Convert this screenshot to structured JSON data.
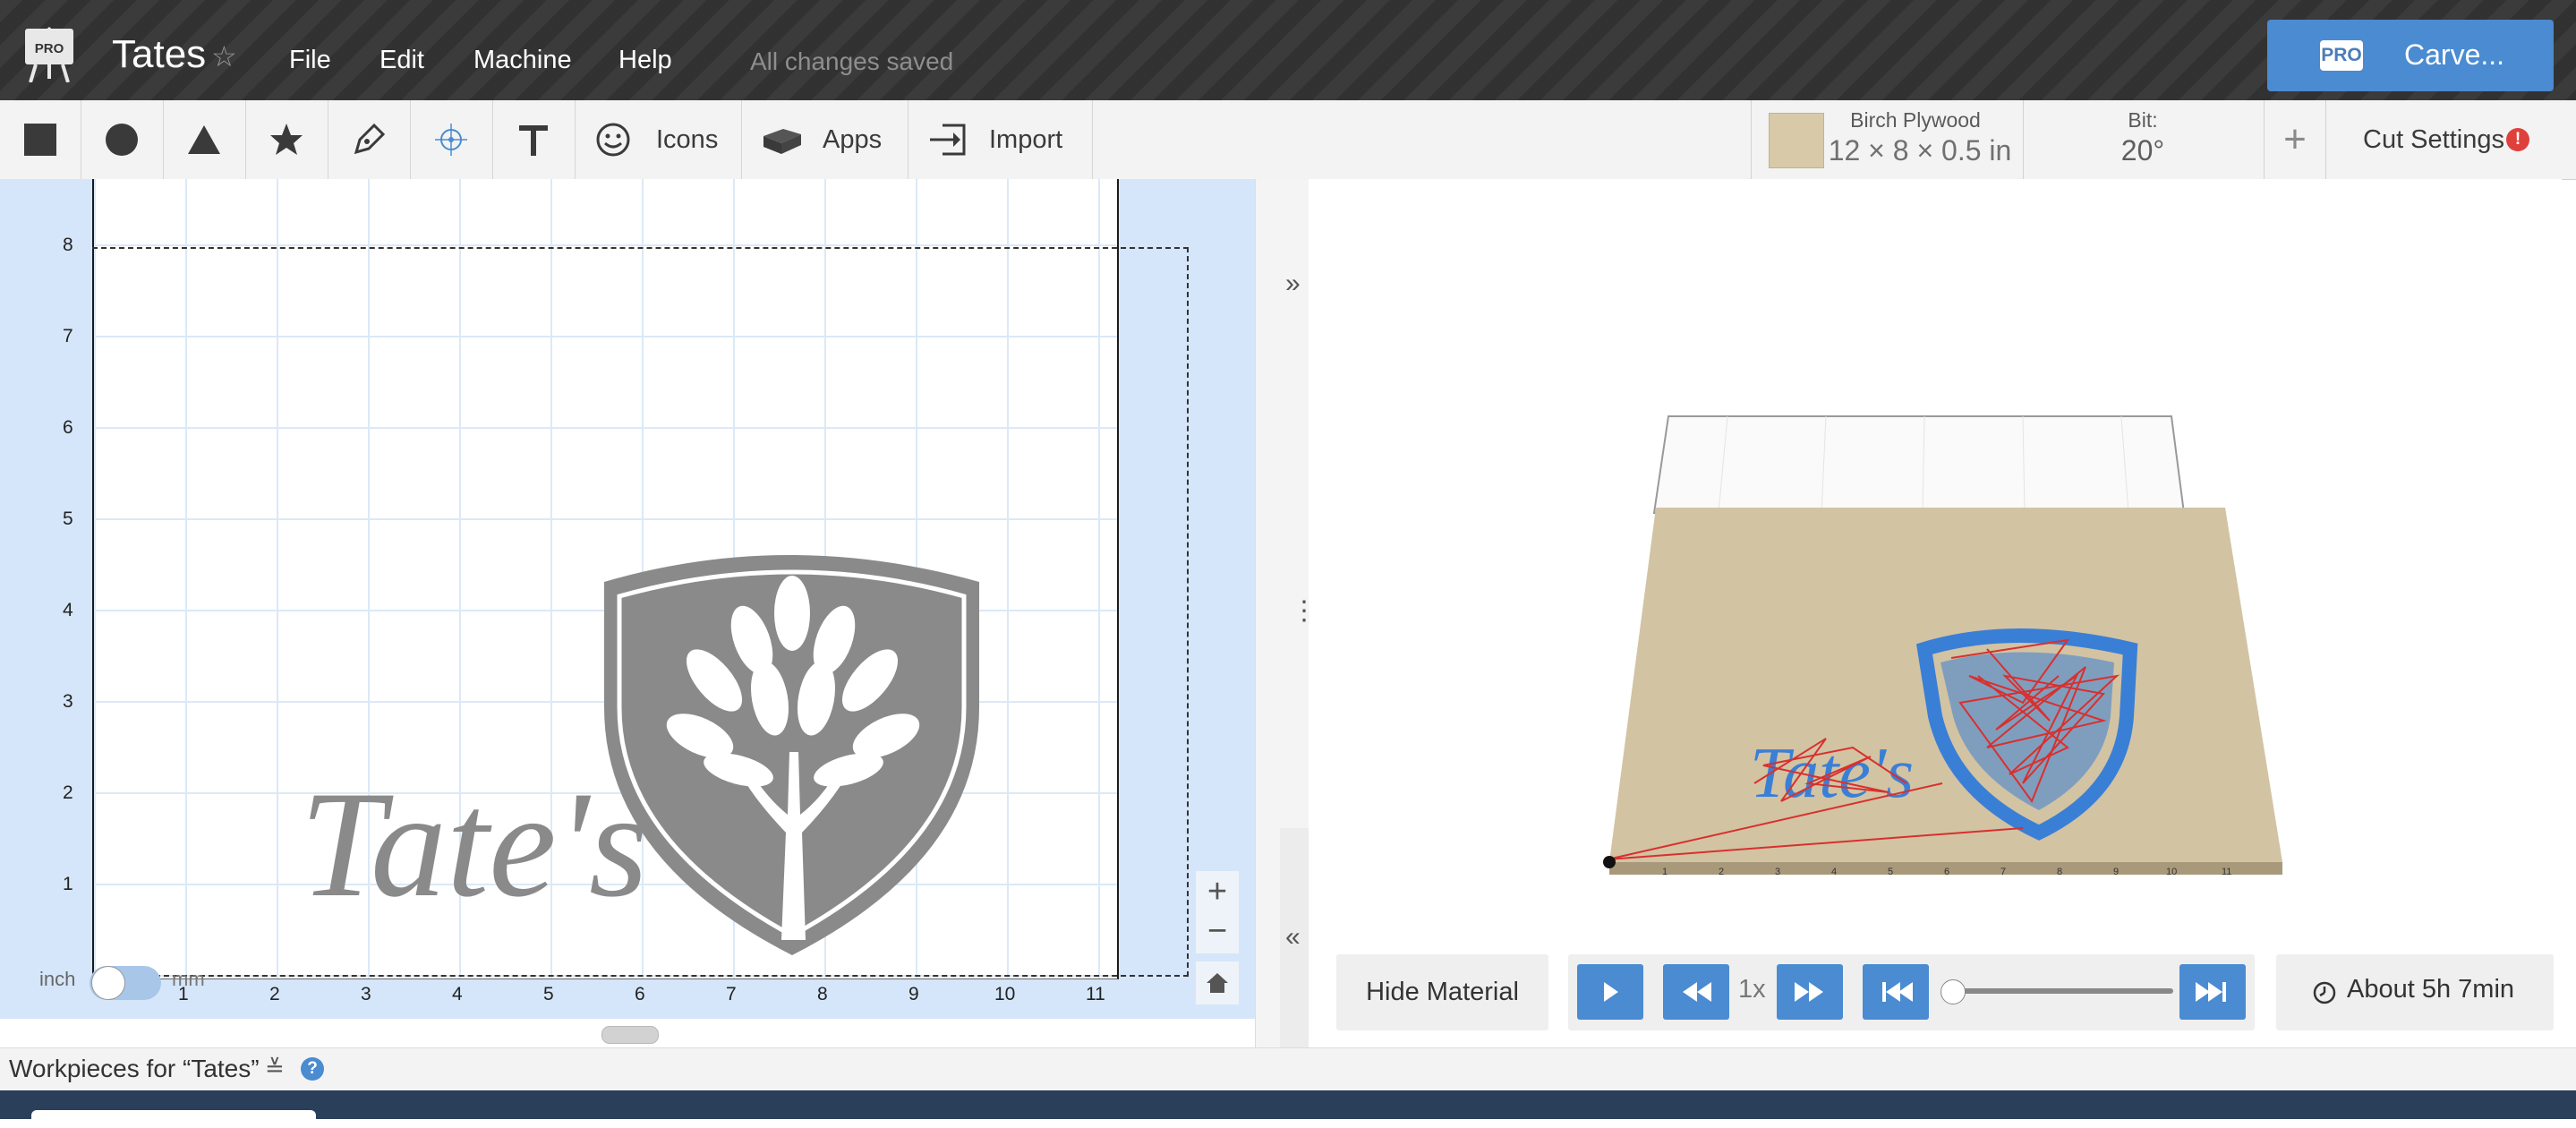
{
  "header": {
    "pro_logo_text": "PRO",
    "project_title": "Tates",
    "menu": [
      "File",
      "Edit",
      "Machine",
      "Help"
    ],
    "save_status": "All changes saved",
    "carve_badge": "PRO",
    "carve_label": "Carve..."
  },
  "toolbar": {
    "icons_label": "Icons",
    "apps_label": "Apps",
    "import_label": "Import",
    "material_name": "Birch Plywood",
    "material_dims": "12 × 8 × 0.5 in",
    "bit_label": "Bit:",
    "bit_value": "20°",
    "add_label": "+",
    "cut_settings_label": "Cut Settings",
    "alert_mark": "!"
  },
  "design": {
    "y_ticks": [
      "8",
      "7",
      "6",
      "5",
      "4",
      "3",
      "2",
      "1"
    ],
    "x_ticks": [
      "1",
      "2",
      "3",
      "4",
      "5",
      "6",
      "7",
      "8",
      "9",
      "10",
      "11"
    ],
    "unit_inch": "inch",
    "unit_mm": "mm",
    "design_text": "Tate's",
    "zoom_in": "+",
    "zoom_out": "−"
  },
  "preview": {
    "engraving_text": "Tate's",
    "hide_material_label": "Hide Material",
    "speed": "1x",
    "time_estimate": "About 5h 7min",
    "axis_ticks": [
      "1",
      "2",
      "3",
      "4",
      "5",
      "6",
      "7",
      "8",
      "9",
      "10",
      "11"
    ]
  },
  "workpieces": {
    "title": "Workpieces for “Tates”",
    "chevron": "≚",
    "help": "?"
  },
  "colors": {
    "accent": "#4a8bd1",
    "topbar": "#343434",
    "design_gray": "#8a8a8a",
    "toolpath_red": "#d8302e",
    "toolpath_blue": "#3a7fd6",
    "wood": "#d2c3a3"
  }
}
